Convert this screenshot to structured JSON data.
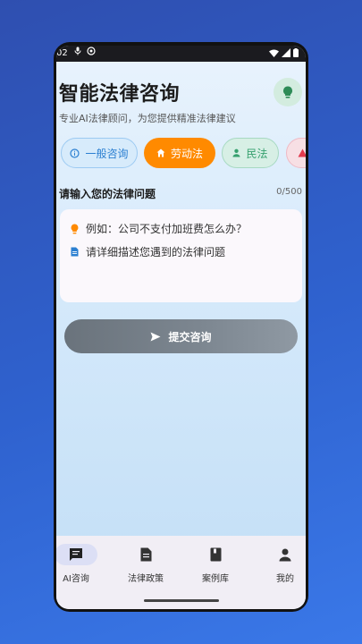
{
  "status_bar": {
    "time": "02"
  },
  "header": {
    "title": "智能法律咨询",
    "subtitle": "专业AI法律顾问，为您提供精准法律建议",
    "tip_icon": "lightbulb-icon"
  },
  "categories": [
    {
      "label": "一般咨询",
      "icon": "info-icon"
    },
    {
      "label": "劳动法",
      "icon": "home-icon"
    },
    {
      "label": "民法",
      "icon": "person-icon"
    },
    {
      "label": "",
      "icon": "warning-icon"
    }
  ],
  "question": {
    "label": "请输入您的法律问题",
    "counter": "0/500",
    "example": "例如：公司不支付加班费怎么办？",
    "placeholder": "请详细描述您遇到的法律问题"
  },
  "submit_label": "提交咨询",
  "bottom_nav": [
    {
      "label": "AI咨询",
      "icon": "chat-icon",
      "active": true
    },
    {
      "label": "法律政策",
      "icon": "document-icon",
      "active": false
    },
    {
      "label": "案例库",
      "icon": "book-icon",
      "active": false
    },
    {
      "label": "我的",
      "icon": "person-icon",
      "active": false
    }
  ],
  "colors": {
    "accent_orange": "#ff8a00",
    "general_blue": "#2b7fd1",
    "civil_green": "#36a06e",
    "warning_red": "#e23a4d"
  }
}
